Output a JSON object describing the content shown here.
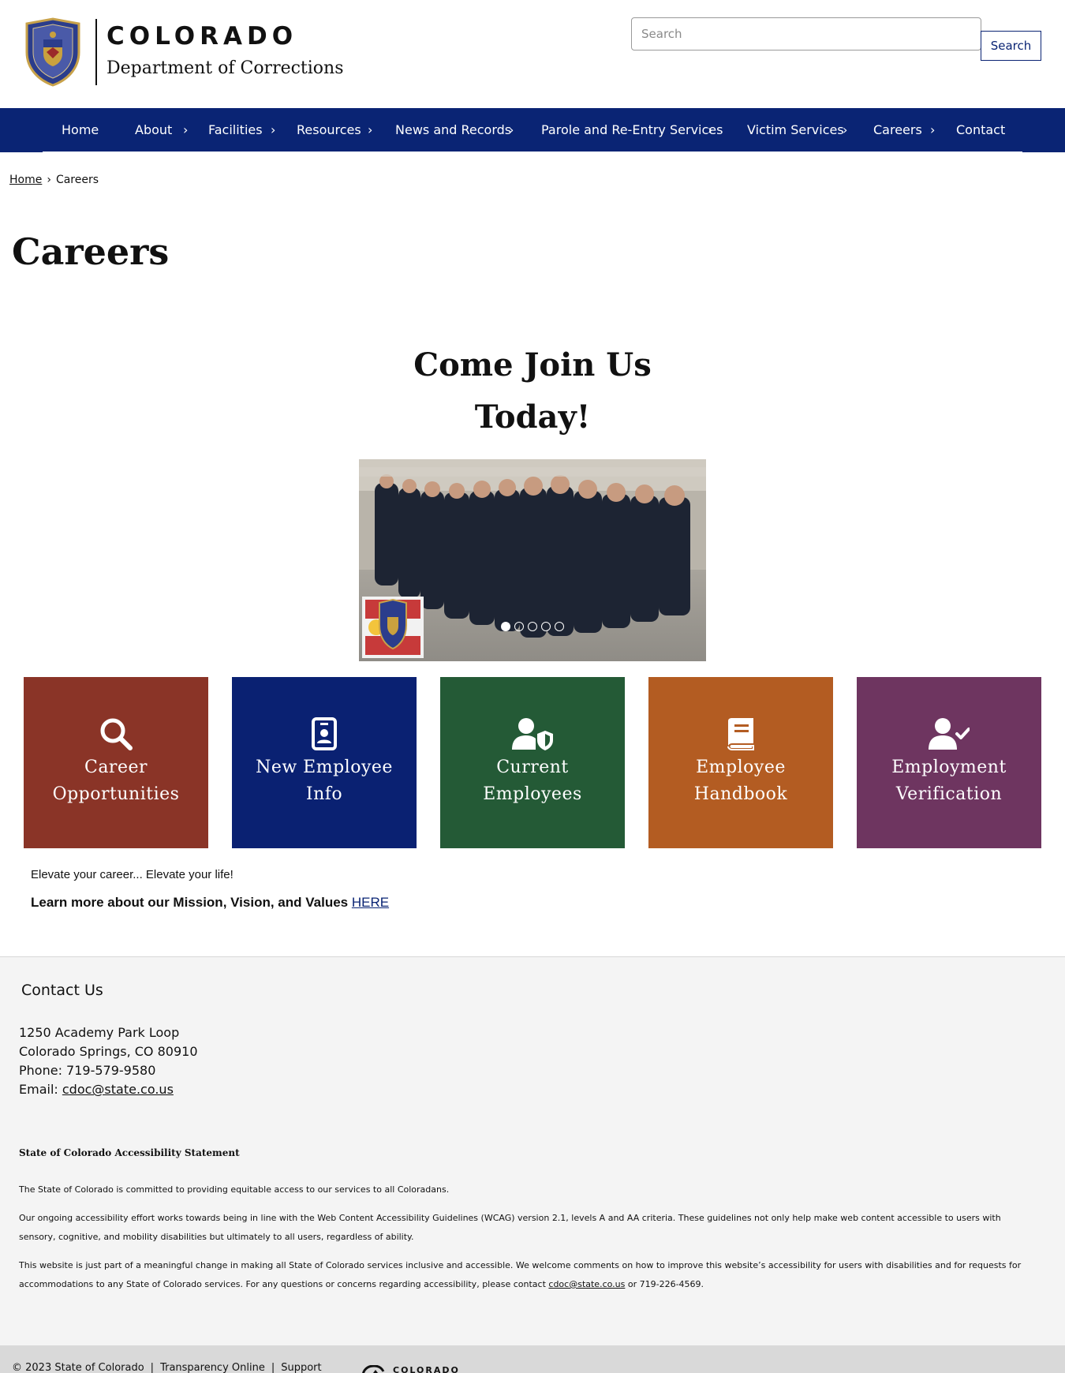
{
  "header": {
    "logo_colorado": "COLORADO",
    "logo_department": "Department of Corrections",
    "search_placeholder": "Search",
    "search_button": "Search"
  },
  "nav": {
    "items": [
      {
        "label": "Home",
        "has_submenu": false
      },
      {
        "label": "About",
        "has_submenu": true
      },
      {
        "label": "Facilities",
        "has_submenu": true
      },
      {
        "label": "Resources",
        "has_submenu": true
      },
      {
        "label": "News and Records",
        "has_submenu": true
      },
      {
        "label": "Parole and Re-Entry Services",
        "has_submenu": true
      },
      {
        "label": "Victim Services",
        "has_submenu": true
      },
      {
        "label": "Careers",
        "has_submenu": true
      },
      {
        "label": "Contact",
        "has_submenu": false
      }
    ]
  },
  "breadcrumb": {
    "home": "Home",
    "current": "Careers"
  },
  "page_title": "Careers",
  "hero": {
    "title_line1": "Come Join Us",
    "title_line2": "Today!",
    "slide_count": 5,
    "active_slide": 1
  },
  "tiles": [
    {
      "line1": "Career",
      "line2": "Opportunities",
      "color": "#8a3427",
      "icon": "search-icon"
    },
    {
      "line1": "New Employee",
      "line2": "Info",
      "color": "#0a2172",
      "icon": "id-badge-icon"
    },
    {
      "line1": "Current",
      "line2": "Employees",
      "color": "#245a36",
      "icon": "user-shield-icon"
    },
    {
      "line1": "Employee",
      "line2": "Handbook",
      "color": "#b35c22",
      "icon": "book-icon"
    },
    {
      "line1": "Employment",
      "line2": "Verification",
      "color": "#6e3560",
      "icon": "user-check-icon"
    }
  ],
  "body": {
    "elevate": "Elevate your career... Elevate your life!",
    "learn_more": "Learn more about our Mission, Vision, and Values",
    "learn_link": "HERE"
  },
  "footer": {
    "contact_title": "Contact Us",
    "address1": "1250 Academy Park Loop",
    "address2": "Colorado Springs, CO 80910",
    "phone": "Phone: 719-579-9580",
    "email_label": "Email:",
    "email": "cdoc@state.co.us",
    "access_title": "State of Colorado Accessibility Statement",
    "access_p1": "The State of Colorado is committed to providing equitable access to our services to all Coloradans.",
    "access_p2": "Our ongoing accessibility effort works towards being in line with the Web Content Accessibility Guidelines (WCAG) version 2.1, levels A and AA criteria. These guidelines not only help make web content accessible to users with sensory, cognitive, and mobility disabilities but ultimately to all users, regardless of ability.",
    "access_p3_pre": "This website is just part of a meaningful change in making all State of Colorado services inclusive and accessible. We welcome comments on how to improve this website’s accessibility for users with disabilities and for requests for accommodations to any State of Colorado services. For any questions or concerns regarding accessibility, please contact",
    "access_p3_email": "cdoc@state.co.us",
    "access_p3_post": "or 719-226-4569.",
    "copyright": "© 2023 State of Colorado",
    "transparency": "Transparency Online",
    "support": "Support",
    "state_logo": "COLORADO"
  },
  "colors": {
    "nav_blue": "#0a2474",
    "footer_bg": "#f4f4f4"
  }
}
